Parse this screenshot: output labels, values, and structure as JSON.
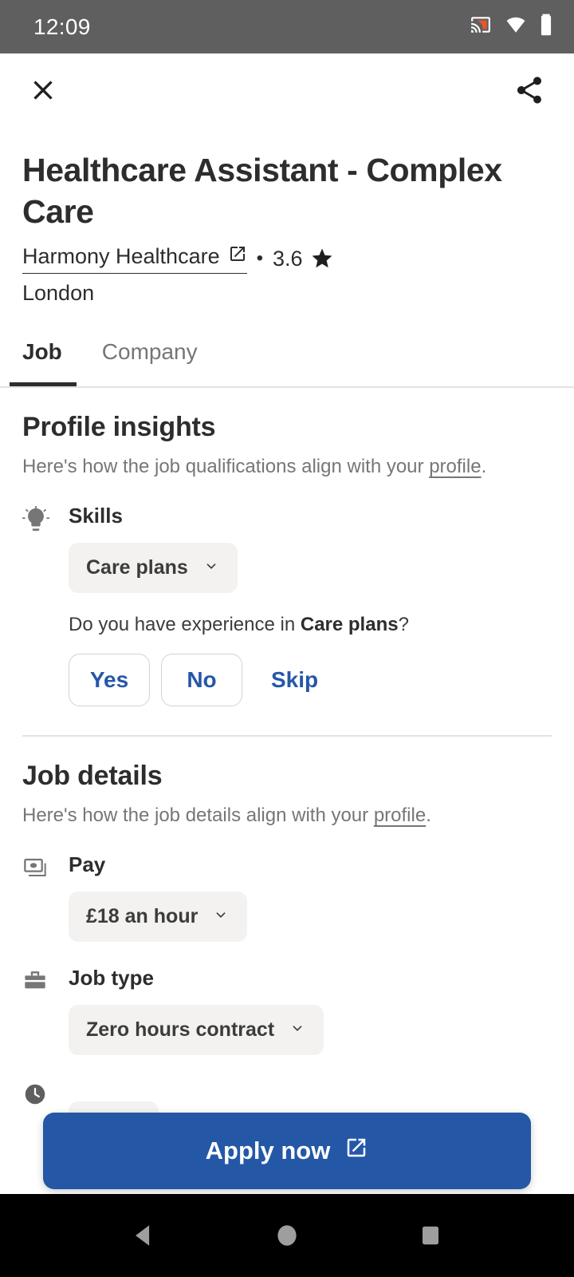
{
  "status_bar": {
    "time": "12:09",
    "icons": [
      "cast-icon",
      "wifi-icon",
      "battery-icon"
    ],
    "background": "#5f5f5f",
    "cast_accent": "#e8562a"
  },
  "app_bar": {
    "close_label": "close-icon",
    "share_label": "share-icon"
  },
  "job": {
    "title": "Healthcare Assistant - Complex Care",
    "company": "Harmony Healthcare",
    "company_link_icon": "external-link-icon",
    "separator": "•",
    "rating": "3.6",
    "star_icon": "star-icon",
    "location": "London"
  },
  "tabs": [
    {
      "label": "Job",
      "active": true
    },
    {
      "label": "Company",
      "active": false
    }
  ],
  "profile_insights": {
    "heading": "Profile insights",
    "subtitle_prefix": "Here's how the job qualifications align with your ",
    "subtitle_link": "profile",
    "subtitle_suffix": ".",
    "skills": {
      "icon": "lightbulb-icon",
      "label": "Skills",
      "chip": "Care plans",
      "chip_chevron": "chevron-down-icon",
      "question_prefix": "Do you have experience in ",
      "question_bold": "Care plans",
      "question_suffix": "?",
      "yes_label": "Yes",
      "no_label": "No",
      "skip_label": "Skip"
    }
  },
  "job_details": {
    "heading": "Job details",
    "subtitle_prefix": "Here's how the job details align with your ",
    "subtitle_link": "profile",
    "subtitle_suffix": ".",
    "pay": {
      "icon": "money-icon",
      "label": "Pay",
      "chip": "£18 an hour",
      "chip_chevron": "chevron-down-icon"
    },
    "job_type": {
      "icon": "briefcase-icon",
      "label": "Job type",
      "chip": "Zero hours contract",
      "chip_chevron": "chevron-down-icon"
    },
    "shift": {
      "icon": "clock-icon"
    }
  },
  "apply": {
    "label": "Apply now",
    "icon": "external-link-icon",
    "color": "#2557a7"
  },
  "nav_bar": {
    "back": "back-triangle-icon",
    "home": "home-circle-icon",
    "recents": "recents-square-icon"
  },
  "colors": {
    "accent_blue": "#2557a7",
    "chip_bg": "#f3f2f1",
    "text_primary": "#2d2d2d",
    "text_secondary": "#767676",
    "divider": "#e4e2e0"
  }
}
